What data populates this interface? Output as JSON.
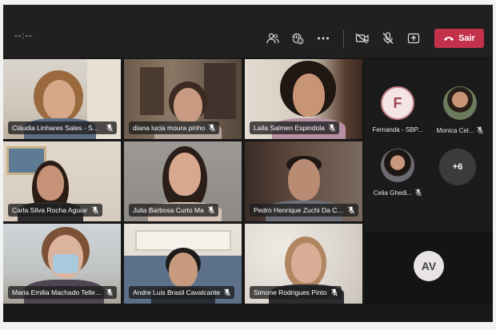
{
  "toolbar": {
    "timer": "--:--",
    "leave_label": "Sair",
    "icons": [
      "people-icon",
      "reactions-icon",
      "more-icon",
      "camera-off-icon",
      "mic-off-icon",
      "share-icon",
      "phone-icon"
    ]
  },
  "tiles": [
    {
      "name": "Cláudia Linhares Sales - SBPC...",
      "muted": true
    },
    {
      "name": "diana lucia moura pinho",
      "muted": true
    },
    {
      "name": "Laila Salmen Espindola",
      "muted": true
    },
    {
      "name": "Carla Silva Rocha Aguiar",
      "muted": true
    },
    {
      "name": "Julia Barbosa Curto Ma",
      "muted": true
    },
    {
      "name": "Pedro Henrique Zuchi Da Co...",
      "muted": true
    },
    {
      "name": "Maria Emilia Machado Telles...",
      "muted": true
    },
    {
      "name": "Andre Luis Brasil Cavalcante",
      "muted": true
    },
    {
      "name": "Simone Rodrigues Pinto",
      "muted": true
    }
  ],
  "side": {
    "participants": [
      {
        "name": "Fernanda - SBP...",
        "initial": "F",
        "muted": false
      },
      {
        "name": "Monica Cel...",
        "initial": "",
        "muted": true
      },
      {
        "name": "Celia Ghedi...",
        "initial": "",
        "muted": true
      }
    ],
    "more_count": "+6",
    "self_initials": "AV"
  },
  "colors": {
    "leave": "#c4314b",
    "avatar_ring": "#c9868e",
    "avatar_fill": "#f3e5e6",
    "avatar_text": "#a0424f"
  }
}
